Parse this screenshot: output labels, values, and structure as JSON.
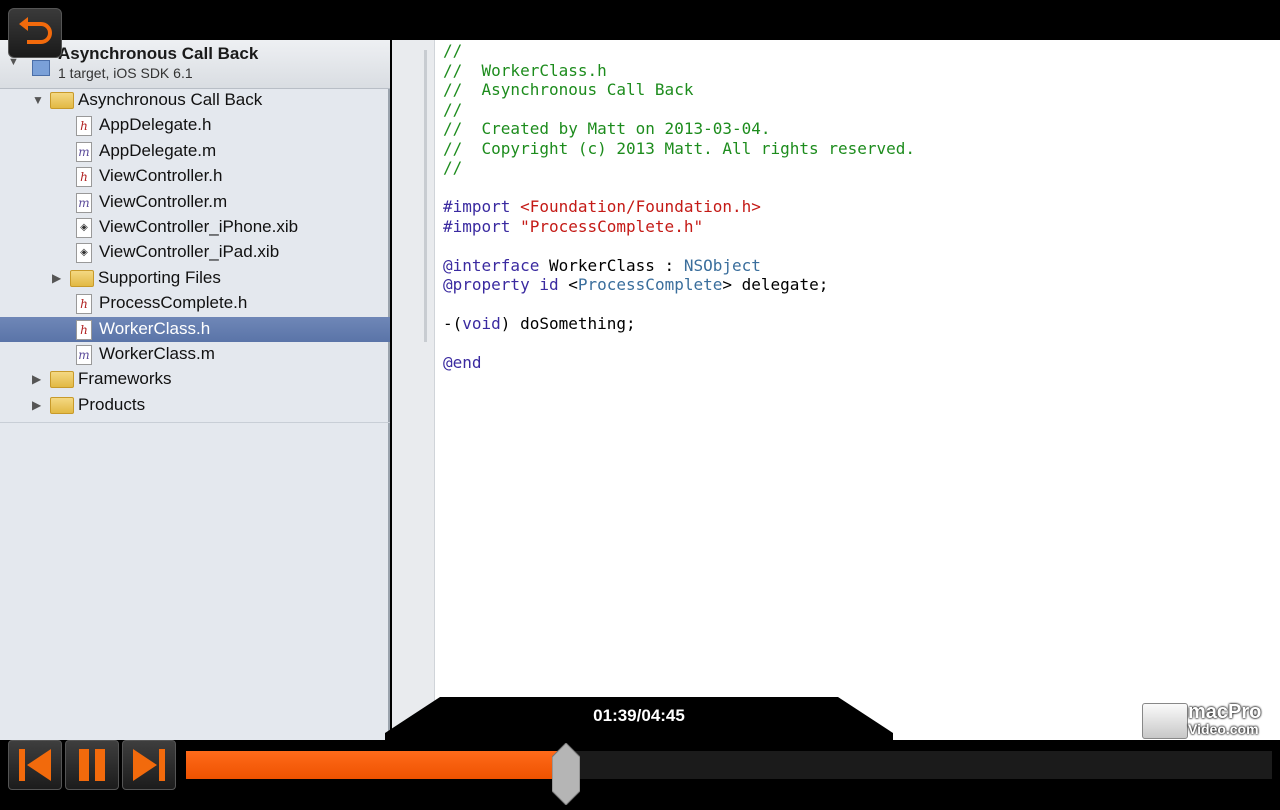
{
  "project": {
    "title": "Asynchronous Call Back",
    "subtitle": "1 target, iOS SDK 6.1"
  },
  "tree": [
    {
      "label": "Asynchronous Call Back",
      "kind": "folder",
      "depth": 1,
      "expanded": true,
      "selected": false
    },
    {
      "label": "AppDelegate.h",
      "kind": "h",
      "depth": 2,
      "selected": false
    },
    {
      "label": "AppDelegate.m",
      "kind": "m",
      "depth": 2,
      "selected": false
    },
    {
      "label": "ViewController.h",
      "kind": "h",
      "depth": 2,
      "selected": false
    },
    {
      "label": "ViewController.m",
      "kind": "m",
      "depth": 2,
      "selected": false
    },
    {
      "label": "ViewController_iPhone.xib",
      "kind": "xib",
      "depth": 2,
      "selected": false
    },
    {
      "label": "ViewController_iPad.xib",
      "kind": "xib",
      "depth": 2,
      "selected": false
    },
    {
      "label": "Supporting Files",
      "kind": "folder",
      "depth": 2,
      "expanded": false,
      "selected": false
    },
    {
      "label": "ProcessComplete.h",
      "kind": "h",
      "depth": 2,
      "selected": false
    },
    {
      "label": "WorkerClass.h",
      "kind": "h",
      "depth": 2,
      "selected": true
    },
    {
      "label": "WorkerClass.m",
      "kind": "m",
      "depth": 2,
      "selected": false
    },
    {
      "label": "Frameworks",
      "kind": "folder",
      "depth": 1,
      "expanded": false,
      "selected": false
    },
    {
      "label": "Products",
      "kind": "folder",
      "depth": 1,
      "expanded": false,
      "selected": false
    }
  ],
  "code": {
    "lines": [
      [
        {
          "t": "//",
          "c": "comment"
        }
      ],
      [
        {
          "t": "//  WorkerClass.h",
          "c": "comment"
        }
      ],
      [
        {
          "t": "//  Asynchronous Call Back",
          "c": "comment"
        }
      ],
      [
        {
          "t": "//",
          "c": "comment"
        }
      ],
      [
        {
          "t": "//  Created by Matt on 2013-03-04.",
          "c": "comment"
        }
      ],
      [
        {
          "t": "//  Copyright (c) 2013 Matt. All rights reserved.",
          "c": "comment"
        }
      ],
      [
        {
          "t": "//",
          "c": "comment"
        }
      ],
      [],
      [
        {
          "t": "#import ",
          "c": "key2"
        },
        {
          "t": "<Foundation/Foundation.h>",
          "c": "str"
        }
      ],
      [
        {
          "t": "#import ",
          "c": "key2"
        },
        {
          "t": "\"ProcessComplete.h\"",
          "c": "str"
        }
      ],
      [],
      [
        {
          "t": "@interface",
          "c": "key2"
        },
        {
          "t": " WorkerClass : ",
          "c": ""
        },
        {
          "t": "NSObject",
          "c": "type"
        }
      ],
      [
        {
          "t": "@property",
          "c": "key2"
        },
        {
          "t": " ",
          "c": ""
        },
        {
          "t": "id",
          "c": "key2"
        },
        {
          "t": " <",
          "c": ""
        },
        {
          "t": "ProcessComplete",
          "c": "type"
        },
        {
          "t": "> delegate;",
          "c": ""
        }
      ],
      [],
      [
        {
          "t": "-(",
          "c": ""
        },
        {
          "t": "void",
          "c": "key2"
        },
        {
          "t": ") doSomething;",
          "c": ""
        }
      ],
      [],
      [
        {
          "t": "@end",
          "c": "key2"
        }
      ]
    ]
  },
  "player": {
    "time": "01:39/04:45",
    "progress": 0.35,
    "logo_line1": "macPro",
    "logo_line2": "Video.com",
    "colors": {
      "progress": "#f05a0a",
      "track": "#1b1b1b"
    },
    "icons": {
      "back": "undo-arrow-icon",
      "prev": "skip-previous-icon",
      "pause": "pause-icon",
      "next": "skip-next-icon"
    }
  }
}
